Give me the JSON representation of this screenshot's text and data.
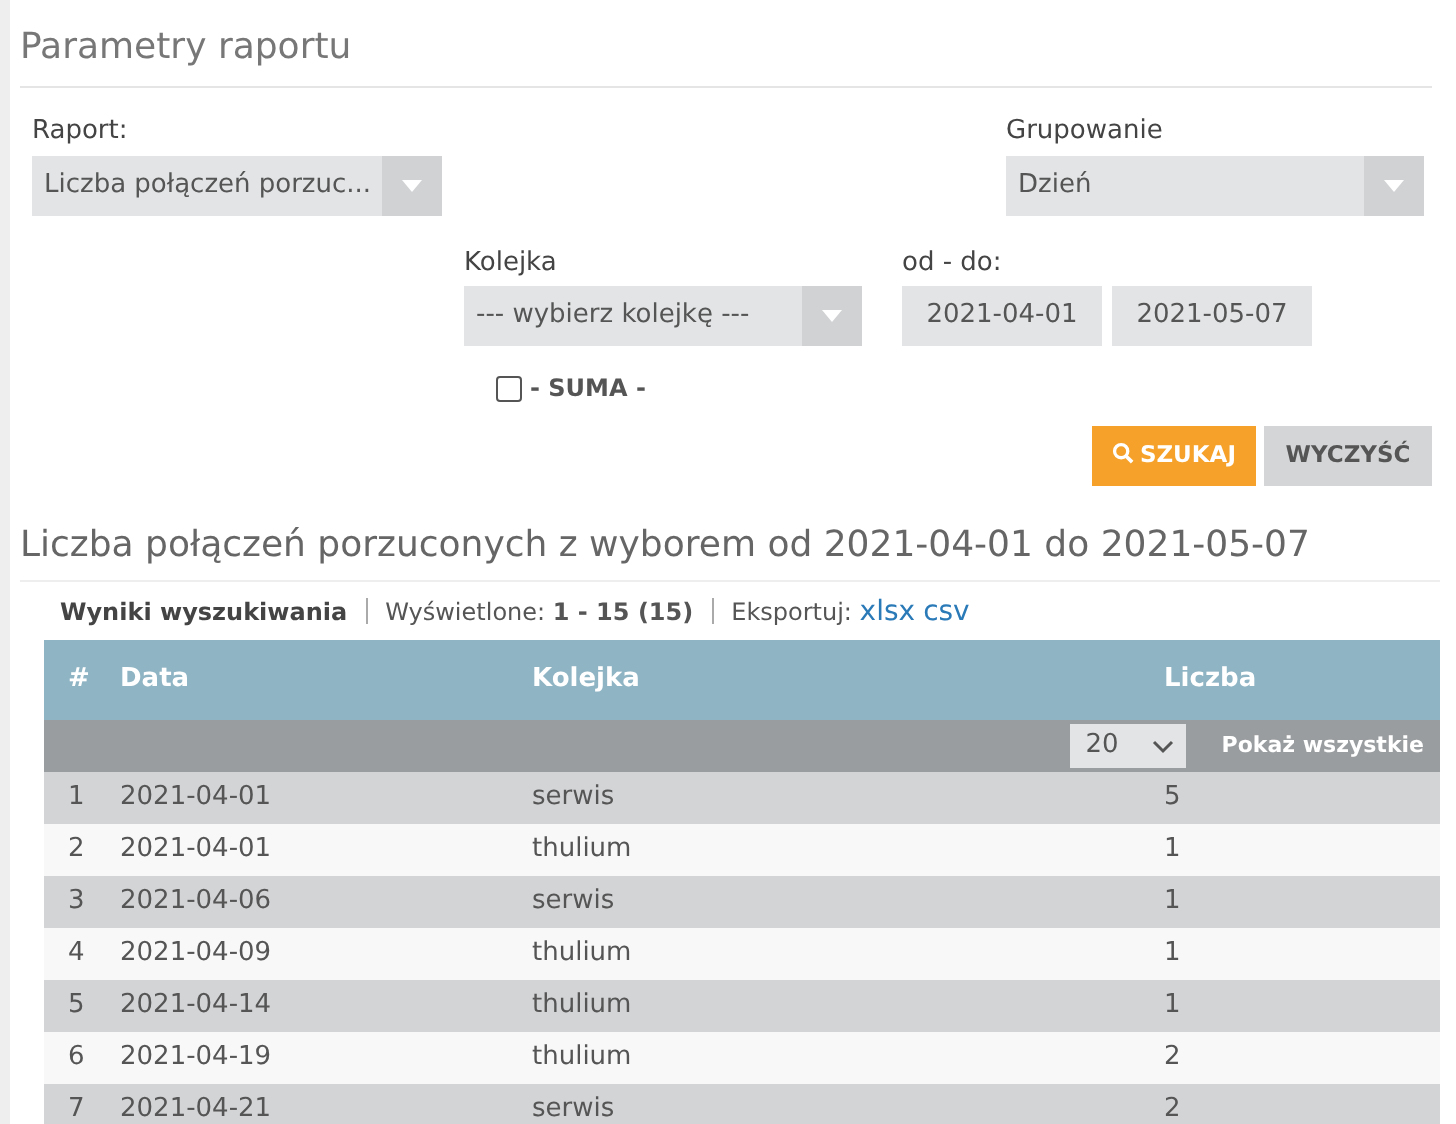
{
  "section_title": "Parametry raportu",
  "fields": {
    "report": {
      "label": "Raport:",
      "value": "Liczba połączeń porzuc..."
    },
    "grouping": {
      "label": "Grupowanie",
      "value": "Dzień"
    },
    "queue": {
      "label": "Kolejka",
      "value": "--- wybierz kolejkę ---"
    },
    "range": {
      "label": "od - do:",
      "from": "2021-04-01",
      "to": "2021-05-07"
    },
    "sum": {
      "label": "- SUMA -",
      "checked": false
    }
  },
  "buttons": [
    {
      "label": "SZUKAJ",
      "kind": "primary"
    },
    {
      "label": "WYCZYŚĆ",
      "kind": "secondary"
    }
  ],
  "results_title": "Liczba połączeń porzuconych z wyborem od 2021-04-01 do 2021-05-07",
  "results_bar": {
    "title": "Wyniki wyszukiwania",
    "shown_label": "Wyświetlone:",
    "shown": "1 - 15 (15)",
    "export_label": "Eksportuj:",
    "export_links": [
      "xlsx",
      "csv"
    ]
  },
  "table": {
    "columns": [
      "#",
      "Data",
      "Kolejka",
      "Liczba"
    ],
    "page_size": "20",
    "show_all": "Pokaż wszystkie",
    "rows": [
      [
        "1",
        "2021-04-01",
        "serwis",
        "5"
      ],
      [
        "2",
        "2021-04-01",
        "thulium",
        "1"
      ],
      [
        "3",
        "2021-04-06",
        "serwis",
        "1"
      ],
      [
        "4",
        "2021-04-09",
        "thulium",
        "1"
      ],
      [
        "5",
        "2021-04-14",
        "thulium",
        "1"
      ],
      [
        "6",
        "2021-04-19",
        "thulium",
        "2"
      ],
      [
        "7",
        "2021-04-21",
        "serwis",
        "2"
      ]
    ]
  }
}
